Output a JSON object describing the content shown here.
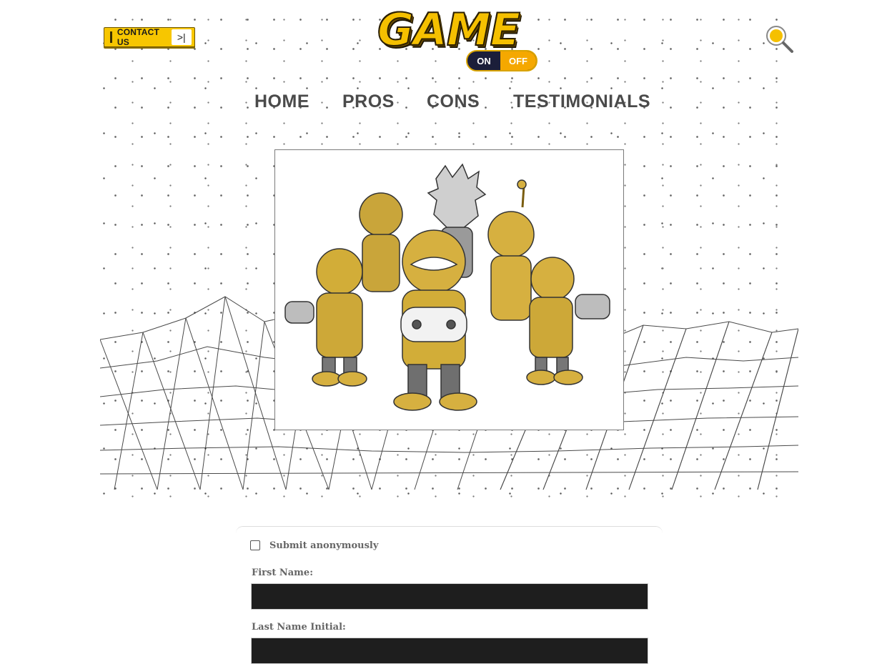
{
  "header": {
    "contact_label": "CONTACT US",
    "contact_arrow": ">|",
    "logo": {
      "word": "GAME",
      "on": "ON",
      "off": "OFF"
    },
    "search_icon": "magnifier-icon"
  },
  "nav": {
    "items": [
      {
        "label": "HOME"
      },
      {
        "label": "PROS"
      },
      {
        "label": "CONS"
      },
      {
        "label": "TESTIMONIALS"
      }
    ]
  },
  "hero": {
    "image": "gamer-squad-illustration"
  },
  "form": {
    "anonymous_label": "Submit anonymously",
    "first_name_label": "First Name:",
    "first_name_value": "",
    "last_initial_label": "Last Name Initial:",
    "last_initial_value": ""
  },
  "colors": {
    "brand_yellow": "#f5c000",
    "nav_text": "#4a4a4a",
    "input_bg": "#1e1e1e"
  }
}
